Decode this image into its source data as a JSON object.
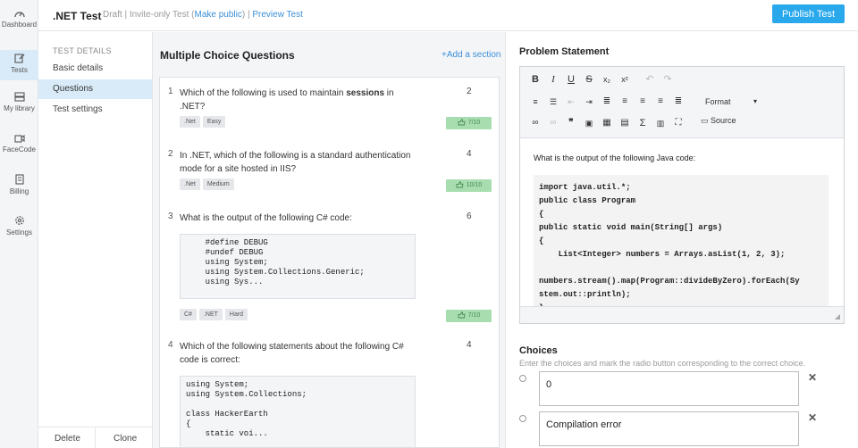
{
  "rail": {
    "items": [
      {
        "label": "Dashboard",
        "icon": "gauge-icon"
      },
      {
        "label": "Tests",
        "icon": "edit-icon",
        "active": true
      },
      {
        "label": "My library",
        "icon": "library-icon"
      },
      {
        "label": "FaceCode",
        "icon": "video-icon"
      },
      {
        "label": "Billing",
        "icon": "billing-icon"
      },
      {
        "label": "Settings",
        "icon": "gear-icon"
      }
    ]
  },
  "header": {
    "title": ".NET Test",
    "status": "Draft",
    "sep1": "|",
    "visibility": "Invite-only Test",
    "make_public_open": "(",
    "make_public": "Make public",
    "make_public_close": ")",
    "sep2": "|",
    "preview": "Preview Test",
    "publish_label": "Publish Test"
  },
  "nav": {
    "section": "TEST DETAILS",
    "items": [
      "Basic details",
      "Questions",
      "Test settings"
    ],
    "active": "Questions",
    "delete_label": "Delete",
    "clone_label": "Clone"
  },
  "questions": {
    "title": "Multiple Choice Questions",
    "add_section": "+Add a section",
    "list": [
      {
        "num": "1",
        "text_a": "Which of the following is used to maintain ",
        "text_bold": "sessions",
        "text_b": " in .NET?",
        "score": "2",
        "tags": [
          ".Net",
          "Easy"
        ],
        "accuracy": "7/10"
      },
      {
        "num": "2",
        "text": "In .NET, which of the following is a standard authentication mode for a site hosted in IIS?",
        "score": "4",
        "tags": [
          ".Net",
          "Medium"
        ],
        "accuracy": "10/10"
      },
      {
        "num": "3",
        "text": "What is the output of the following C# code:",
        "score": "6",
        "code": "    #define DEBUG\n    #undef DEBUG\n    using System;\n    using System.Collections.Generic;\n    using Sys...",
        "tags": [
          "C#",
          ".NET",
          "Hard"
        ],
        "accuracy": "7/10"
      },
      {
        "num": "4",
        "text": "Which of the following statements about the following C# code is correct:",
        "score": "4",
        "code": "using System;\nusing System.Collections;\n\nclass HackerEarth\n{\n    static voi..."
      }
    ]
  },
  "editor": {
    "title": "Problem Statement",
    "format_label": "Format",
    "source_label": "Source",
    "lead": "What is the output of the following Java code:",
    "code": "import java.util.*;\npublic class Program\n{\npublic static void main(String[] args)\n{\n    List<Integer> numbers = Arrays.asList(1, 2, 3);\n\nnumbers.stream().map(Program::divideByZero).forEach(Sy\nstem.out::println);\n}"
  },
  "choices": {
    "title": "Choices",
    "help": "Enter the choices and mark the radio button corresponding to the correct choice.",
    "items": [
      "0",
      "Compilation error"
    ]
  },
  "colors": {
    "accent": "#29a8ec",
    "active_bg": "#d9ebf8",
    "accuracy_bg": "#a8ddb0"
  }
}
